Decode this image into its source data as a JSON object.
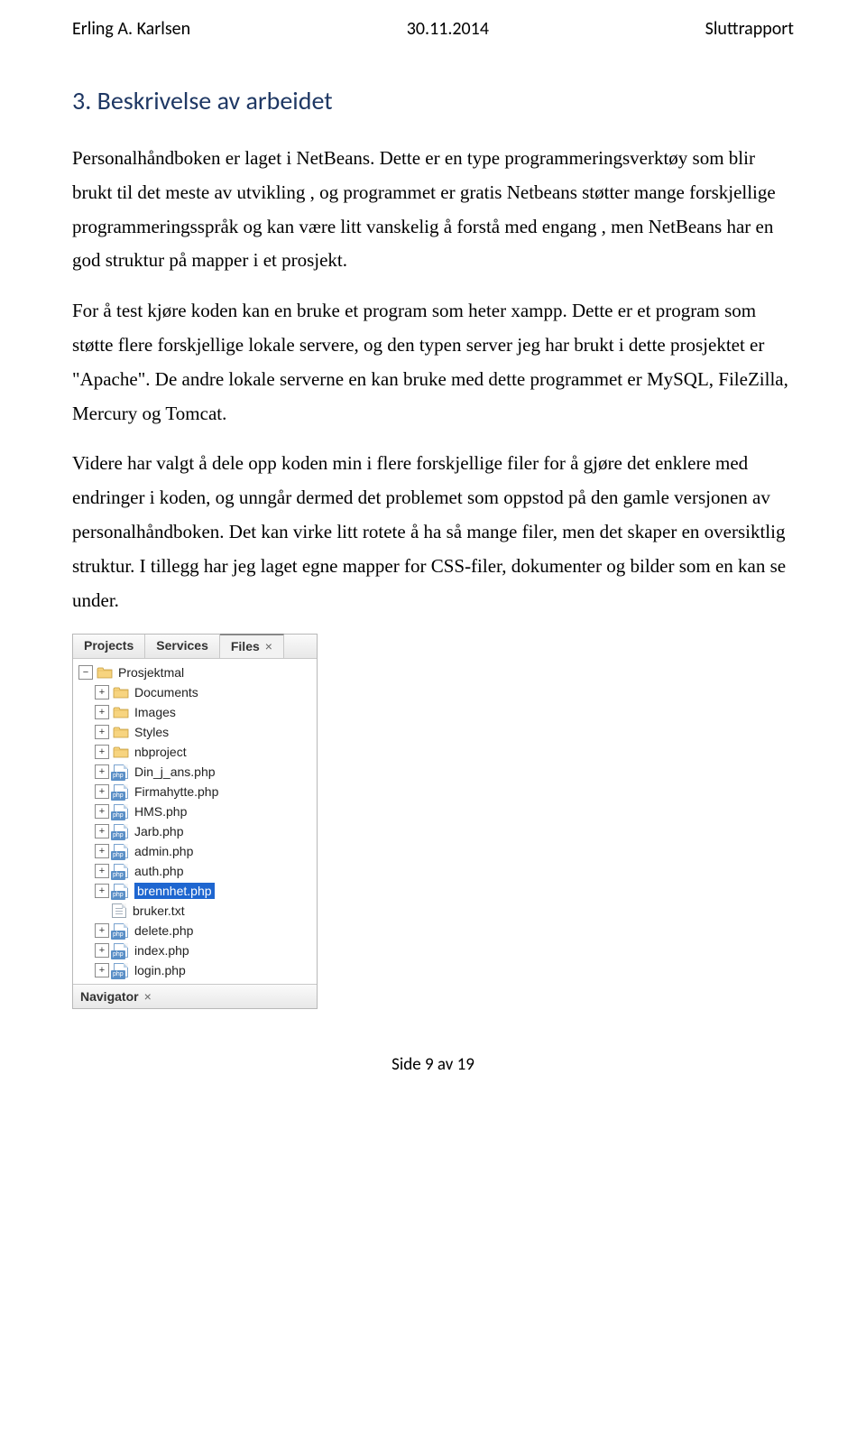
{
  "header": {
    "author": "Erling A. Karlsen",
    "date": "30.11.2014",
    "doc_type": "Sluttrapport"
  },
  "section": {
    "title": "3. Beskrivelse av arbeidet",
    "paragraphs": [
      "Personalhåndboken er laget i NetBeans. Dette er en type programmeringsverktøy som blir brukt til det meste av utvikling , og programmet er gratis Netbeans støtter mange forskjellige programmeringsspråk og kan være litt vanskelig å forstå med engang , men NetBeans har en god struktur på mapper i et prosjekt.",
      "For å test kjøre koden kan en bruke et program som heter xampp. Dette er et program som støtte flere forskjellige lokale servere, og den typen server jeg har brukt i dette prosjektet er \"Apache\". De andre lokale serverne en kan bruke med dette programmet er MySQL, FileZilla, Mercury og Tomcat.",
      "Videre har valgt å dele opp koden min i flere forskjellige filer for å gjøre det enklere med endringer i koden, og unngår dermed det problemet som oppstod på den gamle versjonen av personalhåndboken. Det kan virke litt rotete å ha så mange filer, men det skaper en oversiktlig struktur. I tillegg har jeg laget egne mapper for CSS-filer, dokumenter og bilder som en kan se under."
    ]
  },
  "ide": {
    "tabs": [
      "Projects",
      "Services",
      "Files"
    ],
    "active_tab": "Files",
    "navigator_label": "Navigator",
    "tree": [
      {
        "toggle": "minus",
        "indent": 0,
        "icon": "folder",
        "label": "Prosjektmal",
        "selected": false
      },
      {
        "toggle": "plus",
        "indent": 1,
        "icon": "folder",
        "label": "Documents",
        "selected": false
      },
      {
        "toggle": "plus",
        "indent": 1,
        "icon": "folder",
        "label": "Images",
        "selected": false
      },
      {
        "toggle": "plus",
        "indent": 1,
        "icon": "folder",
        "label": "Styles",
        "selected": false
      },
      {
        "toggle": "plus",
        "indent": 1,
        "icon": "folder",
        "label": "nbproject",
        "selected": false
      },
      {
        "toggle": "plus",
        "indent": 1,
        "icon": "php",
        "label": "Din_j_ans.php",
        "selected": false
      },
      {
        "toggle": "plus",
        "indent": 1,
        "icon": "php",
        "label": "Firmahytte.php",
        "selected": false
      },
      {
        "toggle": "plus",
        "indent": 1,
        "icon": "php",
        "label": "HMS.php",
        "selected": false
      },
      {
        "toggle": "plus",
        "indent": 1,
        "icon": "php",
        "label": "Jarb.php",
        "selected": false
      },
      {
        "toggle": "plus",
        "indent": 1,
        "icon": "php",
        "label": "admin.php",
        "selected": false
      },
      {
        "toggle": "plus",
        "indent": 1,
        "icon": "php",
        "label": "auth.php",
        "selected": false
      },
      {
        "toggle": "plus",
        "indent": 1,
        "icon": "php",
        "label": "brennhet.php",
        "selected": true
      },
      {
        "toggle": "none",
        "indent": 1,
        "icon": "txt",
        "label": "bruker.txt",
        "selected": false
      },
      {
        "toggle": "plus",
        "indent": 1,
        "icon": "php",
        "label": "delete.php",
        "selected": false
      },
      {
        "toggle": "plus",
        "indent": 1,
        "icon": "php",
        "label": "index.php",
        "selected": false
      },
      {
        "toggle": "plus",
        "indent": 1,
        "icon": "php",
        "label": "login.php",
        "selected": false
      }
    ]
  },
  "footer": {
    "page_info": "Side 9 av 19"
  }
}
